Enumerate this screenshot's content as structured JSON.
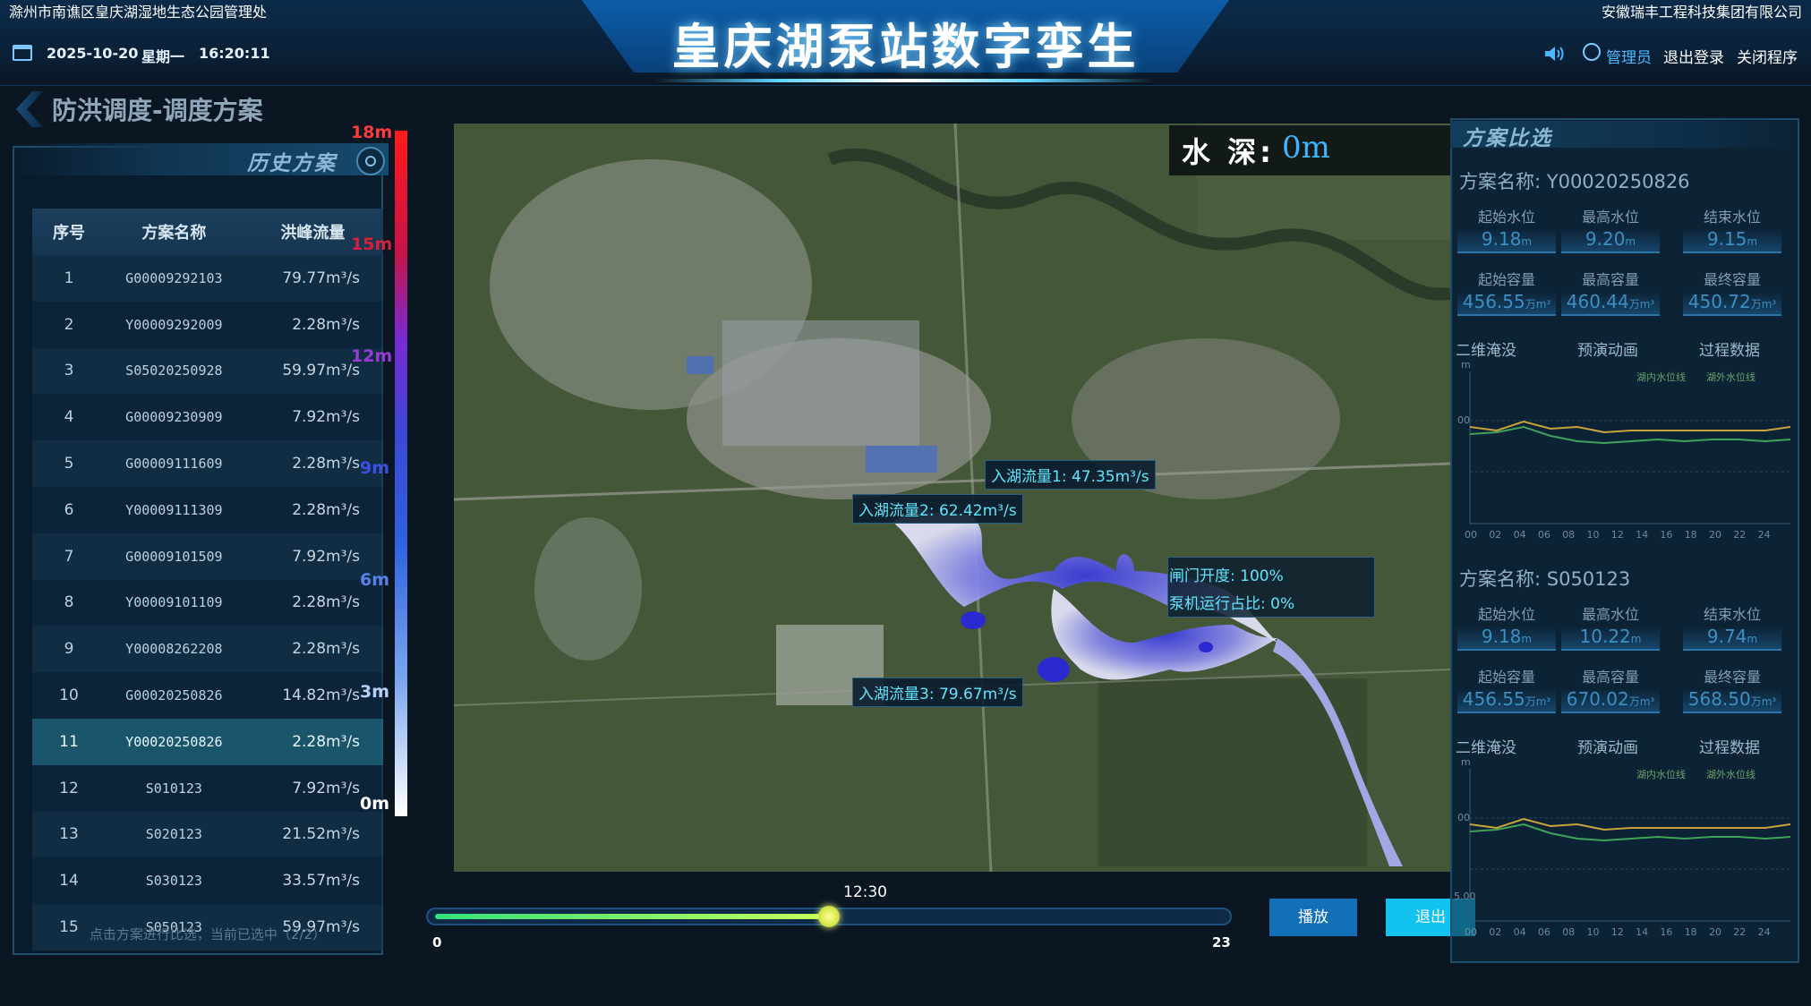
{
  "header": {
    "org_left": "滁州市南谯区皇庆湖湿地生态公园管理处",
    "org_right": "安徽瑞丰工程科技集团有限公司",
    "title": "皇庆湖泵站数字孪生",
    "date": "2025-10-20",
    "weekday": "星期一",
    "time": "16:20:11",
    "user": "管理员",
    "logout": "退出登录",
    "close": "关闭程序"
  },
  "breadcrumb": "防洪调度-调度方案",
  "history": {
    "title": "历史方案",
    "columns": [
      "序号",
      "方案名称",
      "洪峰流量"
    ],
    "rows": [
      {
        "no": "1",
        "name": "G00009292103",
        "flow": "79.77m³/s"
      },
      {
        "no": "2",
        "name": "Y00009292009",
        "flow": "2.28m³/s"
      },
      {
        "no": "3",
        "name": "S05020250928",
        "flow": "59.97m³/s"
      },
      {
        "no": "4",
        "name": "G00009230909",
        "flow": "7.92m³/s"
      },
      {
        "no": "5",
        "name": "G00009111609",
        "flow": "2.28m³/s"
      },
      {
        "no": "6",
        "name": "Y00009111309",
        "flow": "2.28m³/s"
      },
      {
        "no": "7",
        "name": "G00009101509",
        "flow": "7.92m³/s"
      },
      {
        "no": "8",
        "name": "Y00009101109",
        "flow": "2.28m³/s"
      },
      {
        "no": "9",
        "name": "Y00008262208",
        "flow": "2.28m³/s"
      },
      {
        "no": "10",
        "name": "G00020250826",
        "flow": "14.82m³/s"
      },
      {
        "no": "11",
        "name": "Y00020250826",
        "flow": "2.28m³/s"
      },
      {
        "no": "12",
        "name": "S010123",
        "flow": "7.92m³/s"
      },
      {
        "no": "13",
        "name": "S020123",
        "flow": "21.52m³/s"
      },
      {
        "no": "14",
        "name": "S030123",
        "flow": "33.57m³/s"
      },
      {
        "no": "15",
        "name": "S050123",
        "flow": "59.97m³/s"
      }
    ],
    "hint": "点击方案进行比选，当前已选中（2/2）"
  },
  "legend": [
    "18m",
    "15m",
    "12m",
    "9m",
    "6m",
    "3m",
    "0m"
  ],
  "map": {
    "depth_label": "水 深:",
    "depth_value": "0m",
    "inflow1": "入湖流量1: 47.35m³/s",
    "inflow2": "入湖流量2: 62.42m³/s",
    "inflow3": "入湖流量3: 79.67m³/s",
    "gate": "闸门开度: 100%",
    "pump": "泵机运行占比: 0%"
  },
  "timeline": {
    "current": "12:30",
    "min": "0",
    "max": "23",
    "progress": 0.5,
    "play": "播放",
    "exit": "退出"
  },
  "compare": {
    "title": "方案比选",
    "schemes": [
      {
        "name": "方案名称: Y00020250826",
        "stats": [
          {
            "label": "起始水位",
            "value": "9.18",
            "unit": "m"
          },
          {
            "label": "最高水位",
            "value": "9.20",
            "unit": "m"
          },
          {
            "label": "结束水位",
            "value": "9.15",
            "unit": "m"
          },
          {
            "label": "起始容量",
            "value": "456.55",
            "unit": "万m³"
          },
          {
            "label": "最高容量",
            "value": "460.44",
            "unit": "万m³"
          },
          {
            "label": "最终容量",
            "value": "450.72",
            "unit": "万m³"
          }
        ],
        "tabs": [
          "二维淹没",
          "预演动画",
          "过程数据"
        ],
        "legend_in": "湖内水位线",
        "legend_out": "湖外水位线"
      },
      {
        "name": "方案名称: S050123",
        "stats": [
          {
            "label": "起始水位",
            "value": "9.18",
            "unit": "m"
          },
          {
            "label": "最高水位",
            "value": "10.22",
            "unit": "m"
          },
          {
            "label": "结束水位",
            "value": "9.74",
            "unit": "m"
          },
          {
            "label": "起始容量",
            "value": "456.55",
            "unit": "万m³"
          },
          {
            "label": "最高容量",
            "value": "670.02",
            "unit": "万m³"
          },
          {
            "label": "最终容量",
            "value": "568.50",
            "unit": "万m³"
          }
        ],
        "tabs": [
          "二维淹没",
          "预演动画",
          "过程数据"
        ],
        "legend_in": "湖内水位线",
        "legend_out": "湖外水位线"
      }
    ],
    "chart_hours": [
      "00",
      "02",
      "04",
      "06",
      "08",
      "10",
      "12",
      "14",
      "16",
      "18",
      "20",
      "22",
      "24"
    ],
    "chart_y_top": "m",
    "chart_y_mid": "00",
    "chart_y_low": "5.00"
  },
  "colors": {
    "accent": "#12c3ef",
    "play": "#1170b8",
    "depth": "#3fb6ff",
    "tag_text": "#5fe6ff"
  }
}
